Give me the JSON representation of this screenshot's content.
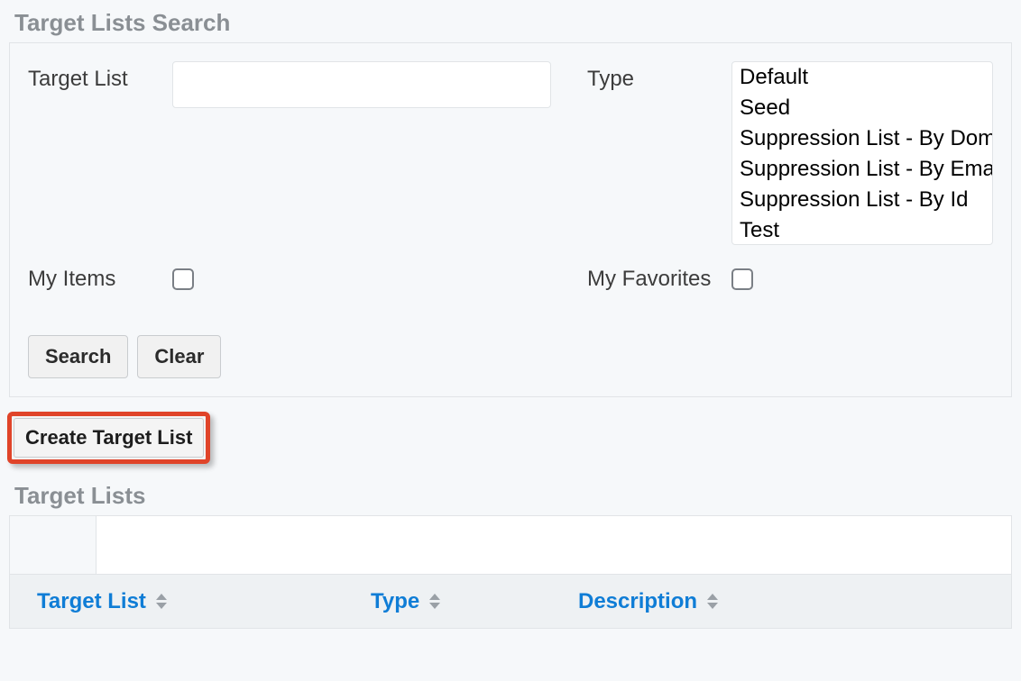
{
  "search_section": {
    "title": "Target Lists Search",
    "target_list_label": "Target List",
    "target_list_value": "",
    "type_label": "Type",
    "type_options": [
      "Default",
      "Seed",
      "Suppression List - By Domain",
      "Suppression List - By Email",
      "Suppression List - By Id",
      "Test"
    ],
    "my_items_label": "My Items",
    "my_favorites_label": "My Favorites",
    "search_button": "Search",
    "clear_button": "Clear"
  },
  "create_button_label": "Create Target List",
  "list_section": {
    "title": "Target Lists",
    "columns": {
      "target_list": "Target List",
      "type": "Type",
      "description": "Description"
    }
  },
  "colors": {
    "link": "#0f7dd6",
    "highlight_border": "#e04429",
    "muted_heading": "#8a8f94"
  }
}
